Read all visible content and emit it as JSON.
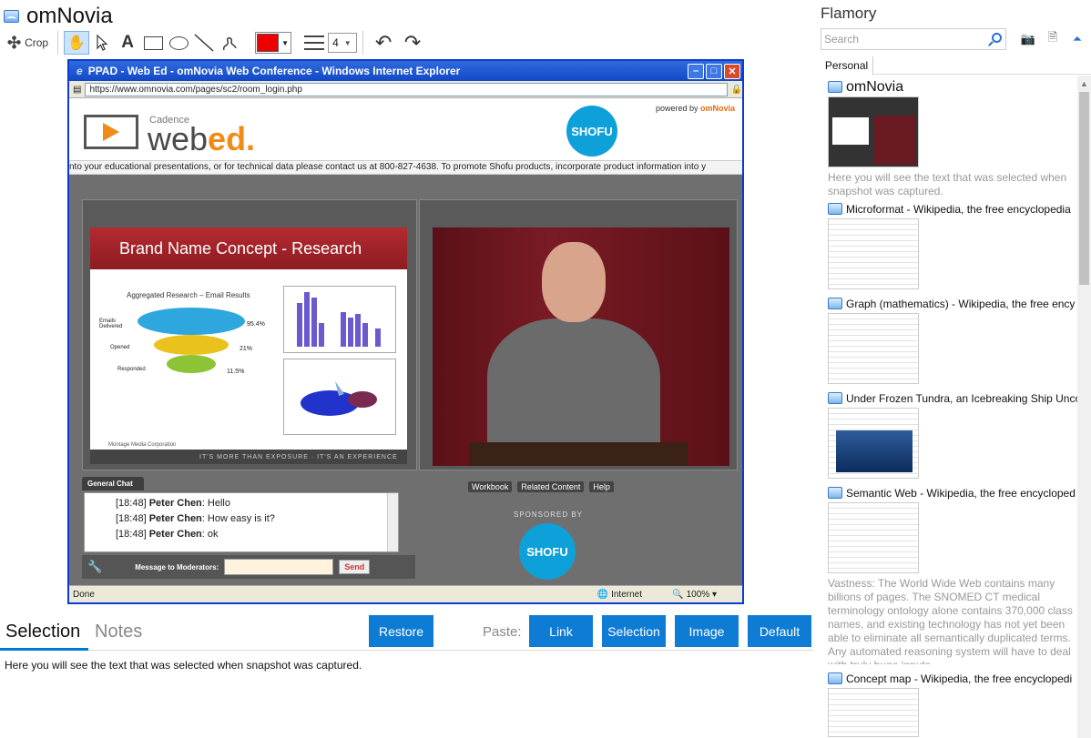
{
  "app": {
    "title": "omNovia"
  },
  "toolbar": {
    "crop_label": "Crop",
    "line_width": "4",
    "color": "#ee0000"
  },
  "snapshot": {
    "window_title": "PPAD - Web Ed - omNovia Web Conference - Windows Internet Explorer",
    "url": "https://www.omnovia.com/pages/sc2/room_login.php",
    "brand_prefix": "Cadence",
    "brand_web": "web",
    "brand_ed": "ed.",
    "powered_by": "powered by",
    "powered_brand": "omNovia",
    "shofu": "SHOFU",
    "ticker": "nto your educational presentations, or for technical data please contact us at 800-827-4638.        To promote Shofu products, incorporate product information into y",
    "slide_title": "Brand Name Concept - Research",
    "slide_subtitle": "Aggregated Research – Email Results",
    "funnel": [
      {
        "label": "Emails Delivered",
        "value": "95.4%"
      },
      {
        "label": "Opened",
        "value": "21%"
      },
      {
        "label": "Responded",
        "value": "11.5%"
      }
    ],
    "slide_company": "Montage Media Corporation",
    "slide_footer": "IT'S MORE THAN EXPOSURE · IT'S AN EXPERIENCE",
    "chat_tab": "General Chat",
    "chat": [
      {
        "time": "[18:48]",
        "name": "Peter Chen",
        "msg": ": Hello"
      },
      {
        "time": "[18:48]",
        "name": "Peter Chen",
        "msg": ": How easy is it?"
      },
      {
        "time": "[18:48]",
        "name": "Peter Chen",
        "msg": ": ok"
      }
    ],
    "message_label": "Message to Moderators:",
    "send_label": "Send",
    "nav_links": [
      "Workbook",
      "Related Content",
      "Help"
    ],
    "sponsored_by": "SPONSORED BY",
    "status_done": "Done",
    "status_zone": "Internet",
    "status_zoom": "100%"
  },
  "lower": {
    "tab_selection": "Selection",
    "tab_notes": "Notes",
    "restore": "Restore",
    "paste_label": "Paste:",
    "paste_link": "Link",
    "paste_selection": "Selection",
    "paste_image": "Image",
    "paste_default": "Default",
    "selection_text": "Here you will see the text that was selected when snapshot was captured."
  },
  "sidebar": {
    "title": "Flamory",
    "search_placeholder": "Search",
    "tab_personal": "Personal",
    "entries": [
      {
        "title": "omNovia",
        "desc": "Here you will see the text that was selected when snapshot was captured."
      },
      {
        "title": "Microformat - Wikipedia, the free encyclopedia",
        "desc": ""
      },
      {
        "title": "Graph (mathematics) - Wikipedia, the free ency",
        "desc": ""
      },
      {
        "title": "Under Frozen Tundra, an Icebreaking Ship Unco",
        "desc": ""
      },
      {
        "title": "Semantic Web - Wikipedia, the free encycloped",
        "desc": "Vastness: The World Wide Web contains many billions of pages. The SNOMED CT medical terminology ontology alone contains 370,000 class names, and existing technology has not yet been able to eliminate all semantically duplicated terms. Any automated reasoning system will have to deal with truly huge inputs."
      },
      {
        "title": "Concept map - Wikipedia, the free encyclopedi",
        "desc": ""
      }
    ]
  },
  "colors": {
    "accent": "#0e7cd4",
    "tab_underline": "#0078d4"
  }
}
